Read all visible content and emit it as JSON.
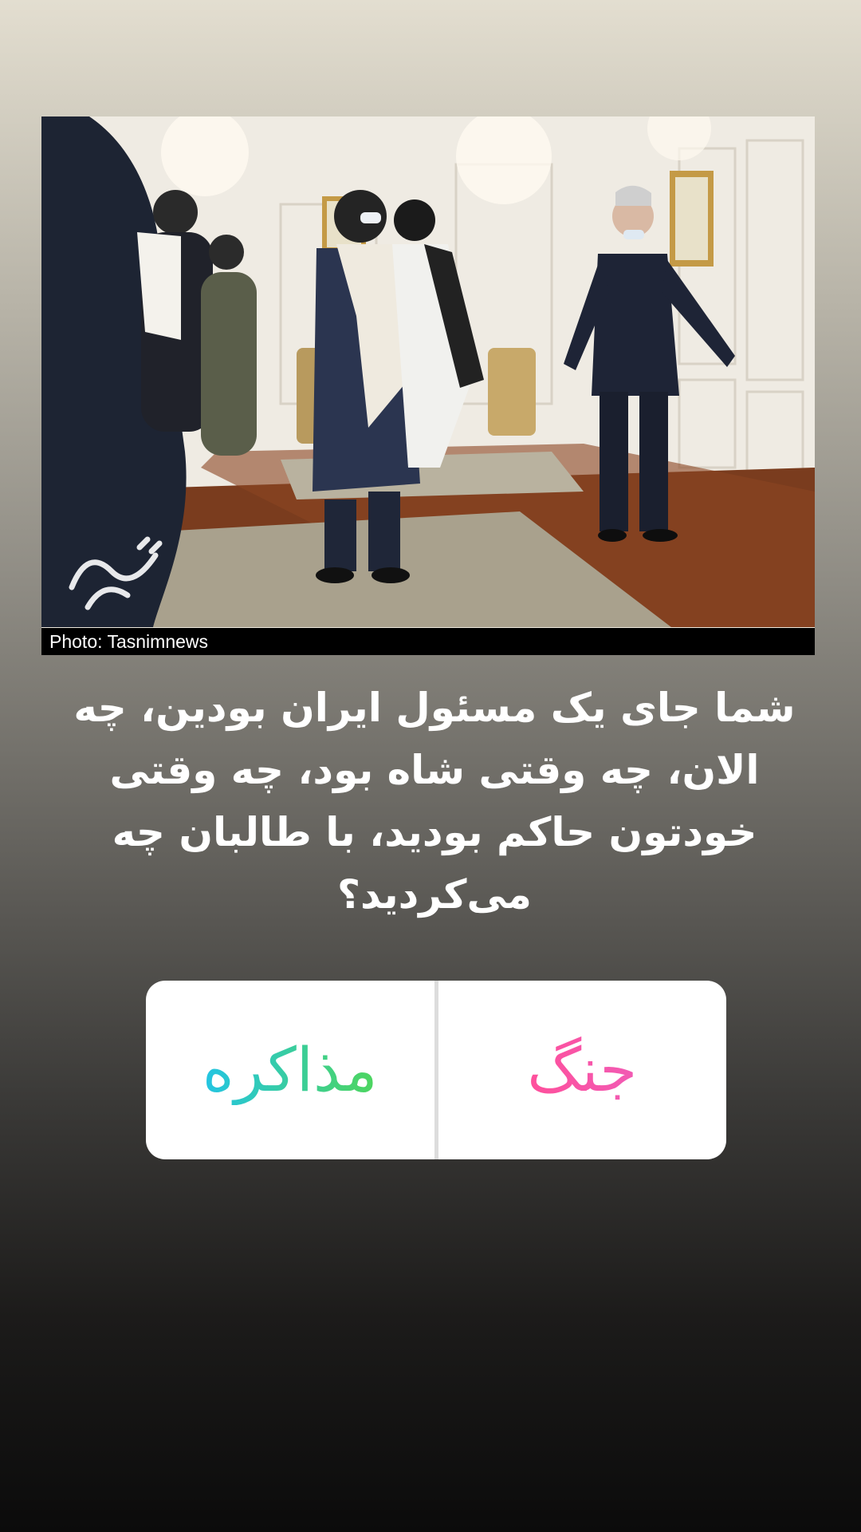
{
  "photo": {
    "caption": "Photo: Tasnimnews",
    "watermark_icon": "tasnim-logo-icon"
  },
  "question": {
    "text": "شما جای یک مسئول ایران بودین، چه الان، چه وقتی شاه بود، چه وقتی خودتون حاکم بودید، با طالبان چه می‌کردید؟"
  },
  "poll": {
    "option_left": {
      "label": "مذاکره",
      "gradient": [
        "#22c4e6",
        "#4fd65a"
      ]
    },
    "option_right": {
      "label": "جنگ",
      "gradient": [
        "#ff4f9a",
        "#f15bb5"
      ]
    }
  }
}
